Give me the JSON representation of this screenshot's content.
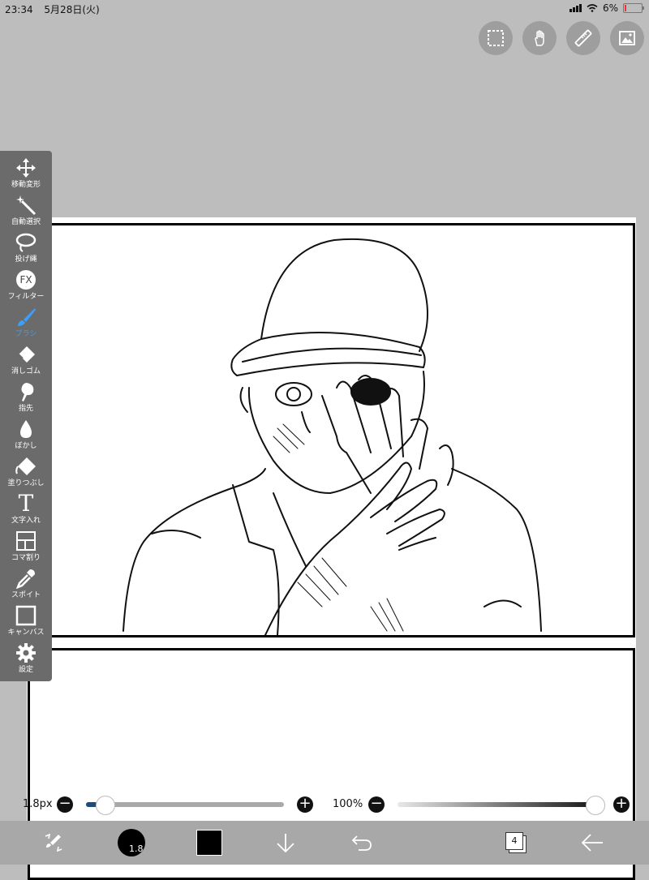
{
  "status": {
    "time": "23:34",
    "date": "5月28日(火)",
    "battery": "6%"
  },
  "top_buttons": [
    "selection-icon",
    "touch-icon",
    "ruler-icon",
    "image-icon"
  ],
  "tools": [
    {
      "name": "move",
      "label": "移動変形",
      "icon": "move-icon"
    },
    {
      "name": "magic-wand",
      "label": "自動選択",
      "icon": "magic-wand-icon"
    },
    {
      "name": "lasso",
      "label": "投げ縄",
      "icon": "lasso-icon"
    },
    {
      "name": "filter",
      "label": "フィルター",
      "icon": "fx-icon",
      "glyph": "FX"
    },
    {
      "name": "brush",
      "label": "ブラシ",
      "icon": "brush-icon",
      "active": true
    },
    {
      "name": "eraser",
      "label": "消しゴム",
      "icon": "eraser-icon"
    },
    {
      "name": "smudge",
      "label": "指先",
      "icon": "smudge-icon"
    },
    {
      "name": "blur",
      "label": "ぼかし",
      "icon": "blur-drop-icon"
    },
    {
      "name": "fill",
      "label": "塗りつぶし",
      "icon": "fill-bucket-icon"
    },
    {
      "name": "text",
      "label": "文字入れ",
      "icon": "text-icon",
      "glyph": "T"
    },
    {
      "name": "frame",
      "label": "コマ割り",
      "icon": "frame-divider-icon"
    },
    {
      "name": "eyedropper",
      "label": "スポイト",
      "icon": "eyedropper-icon"
    },
    {
      "name": "canvas",
      "label": "キャンバス",
      "icon": "canvas-icon"
    },
    {
      "name": "settings",
      "label": "設定",
      "icon": "gear-icon"
    }
  ],
  "brush_size": {
    "label": "1.8px",
    "value_fraction": 0.03
  },
  "opacity": {
    "label": "100%",
    "value_fraction": 1.0
  },
  "bottom": {
    "brush_indicator": "1.8",
    "layer_count": "4"
  },
  "colors": {
    "primary": "#000000",
    "accent": "#3aa0ff",
    "toolbar_bg": "#6b6b6b"
  }
}
